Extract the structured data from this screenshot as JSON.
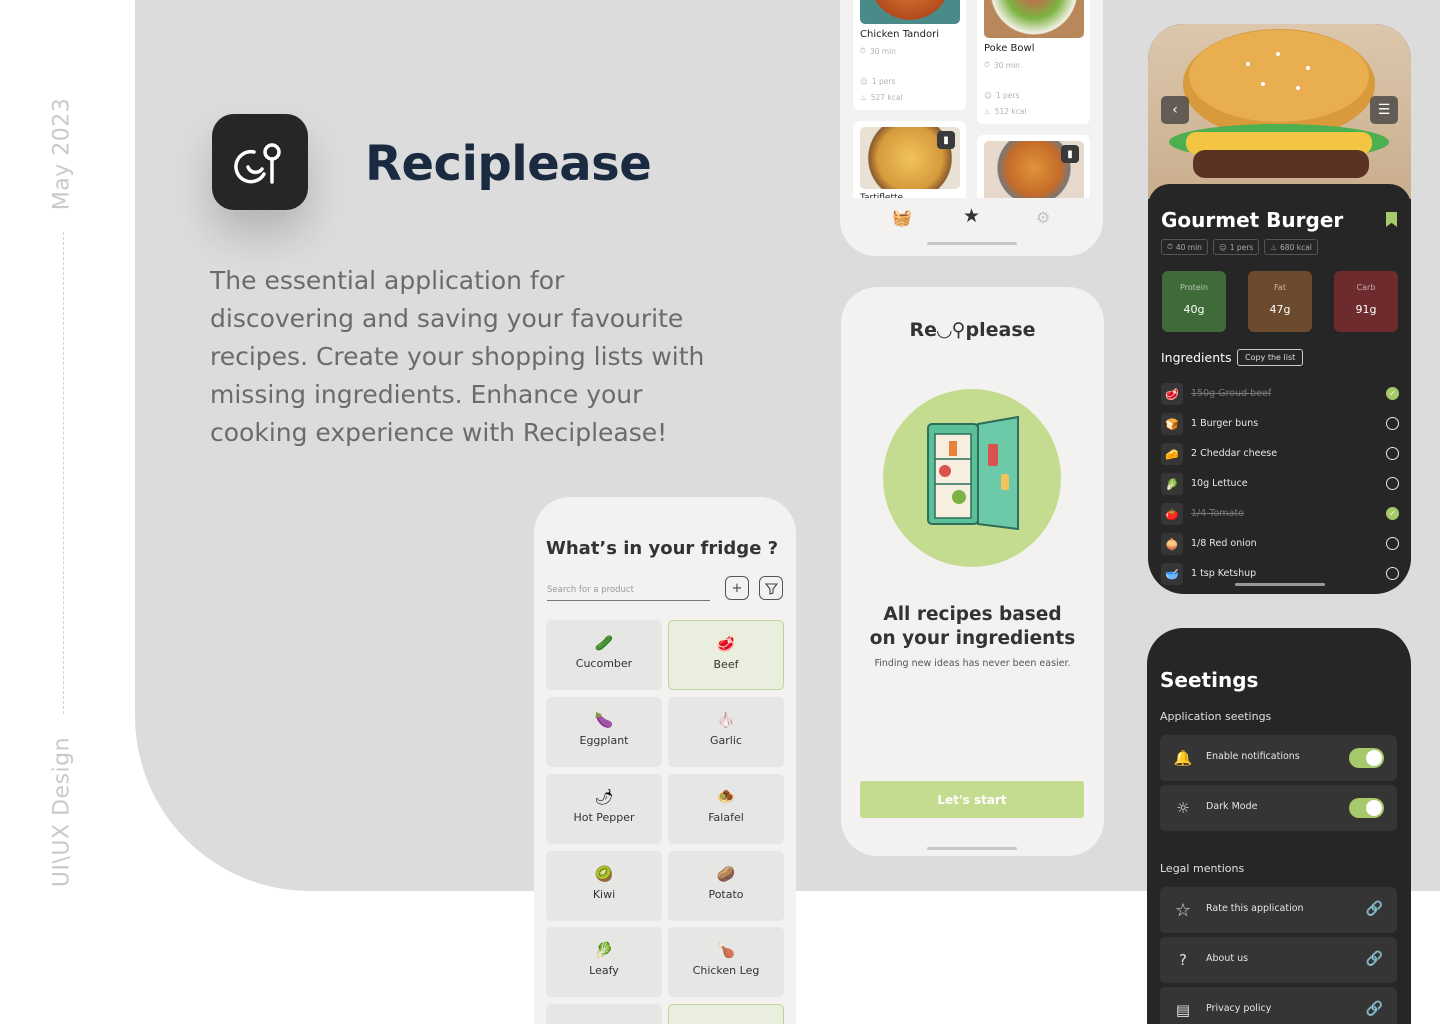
{
  "sidebar": {
    "date": "May 2023",
    "role": "UI\\UX Design"
  },
  "brand": {
    "name": "Reciplease",
    "tagline": "The essential application for discovering and saving your favourite recipes. Create your shopping lists with missing ingredients. Enhance your cooking experience with Reciplease!"
  },
  "favourites": {
    "cards": [
      {
        "title": "Chicken Tandori",
        "time": "30 min",
        "pers": "1 pers",
        "kcal": "527 kcal"
      },
      {
        "title": "Poke Bowl",
        "time": "30 min",
        "pers": "1 pers",
        "kcal": "512 kcal"
      },
      {
        "title": "Tartiflette"
      }
    ]
  },
  "fridge": {
    "title": "What’s in your fridge ?",
    "search_placeholder": "Search for a product",
    "items": [
      {
        "label": "Cucomber",
        "icon": "cucumber-icon",
        "selected": false
      },
      {
        "label": "Beef",
        "icon": "beef-icon",
        "selected": true
      },
      {
        "label": "Eggplant",
        "icon": "eggplant-icon",
        "selected": false
      },
      {
        "label": "Garlic",
        "icon": "garlic-icon",
        "selected": false
      },
      {
        "label": "Hot Pepper",
        "icon": "hot-pepper-icon",
        "selected": false
      },
      {
        "label": "Falafel",
        "icon": "falafel-icon",
        "selected": false
      },
      {
        "label": "Kiwi",
        "icon": "kiwi-icon",
        "selected": false
      },
      {
        "label": "Potato",
        "icon": "potato-icon",
        "selected": false
      },
      {
        "label": "Leafy",
        "icon": "leafy-icon",
        "selected": false
      },
      {
        "label": "Chicken Leg",
        "icon": "chicken-leg-icon",
        "selected": false
      }
    ]
  },
  "onboarding": {
    "logo": "Re◡⚲please",
    "heading_line1": "All recipes based",
    "heading_line2": "on your ingredients",
    "subtitle": "Finding new ideas has never been easier.",
    "cta": "Let's start"
  },
  "recipe": {
    "title": "Gourmet Burger",
    "time": "40 min",
    "pers": "1 pers",
    "kcal": "680 kcal",
    "macros": [
      {
        "label": "Protein",
        "value": "40g",
        "color": "#3f6b39"
      },
      {
        "label": "Fat",
        "value": "47g",
        "color": "#6b4a2e"
      },
      {
        "label": "Carb",
        "value": "91g",
        "color": "#6e2b2d"
      }
    ],
    "ingredients_title": "Ingredients",
    "copy_label": "Copy the list",
    "ingredients": [
      {
        "label": "150g Groud beef",
        "checked": true
      },
      {
        "label": "1 Burger buns",
        "checked": false
      },
      {
        "label": "2 Cheddar cheese",
        "checked": false
      },
      {
        "label": "10g Lettuce",
        "checked": false
      },
      {
        "label": "1/4 Tomato",
        "checked": true
      },
      {
        "label": "1/8 Red onion",
        "checked": false
      },
      {
        "label": "1 tsp Ketshup",
        "checked": false
      }
    ]
  },
  "settings": {
    "title": "Seetings",
    "app_section": "Application seetings",
    "notifications": "Enable notifications",
    "dark_mode": "Dark Mode",
    "legal_section": "Legal mentions",
    "rate": "Rate this application",
    "about": "About us",
    "privacy": "Privacy policy"
  },
  "colors": {
    "accent": "#c4dc8f",
    "toggle": "#a6c96b",
    "dark": "#262626",
    "panel": "#dcdcdd"
  }
}
